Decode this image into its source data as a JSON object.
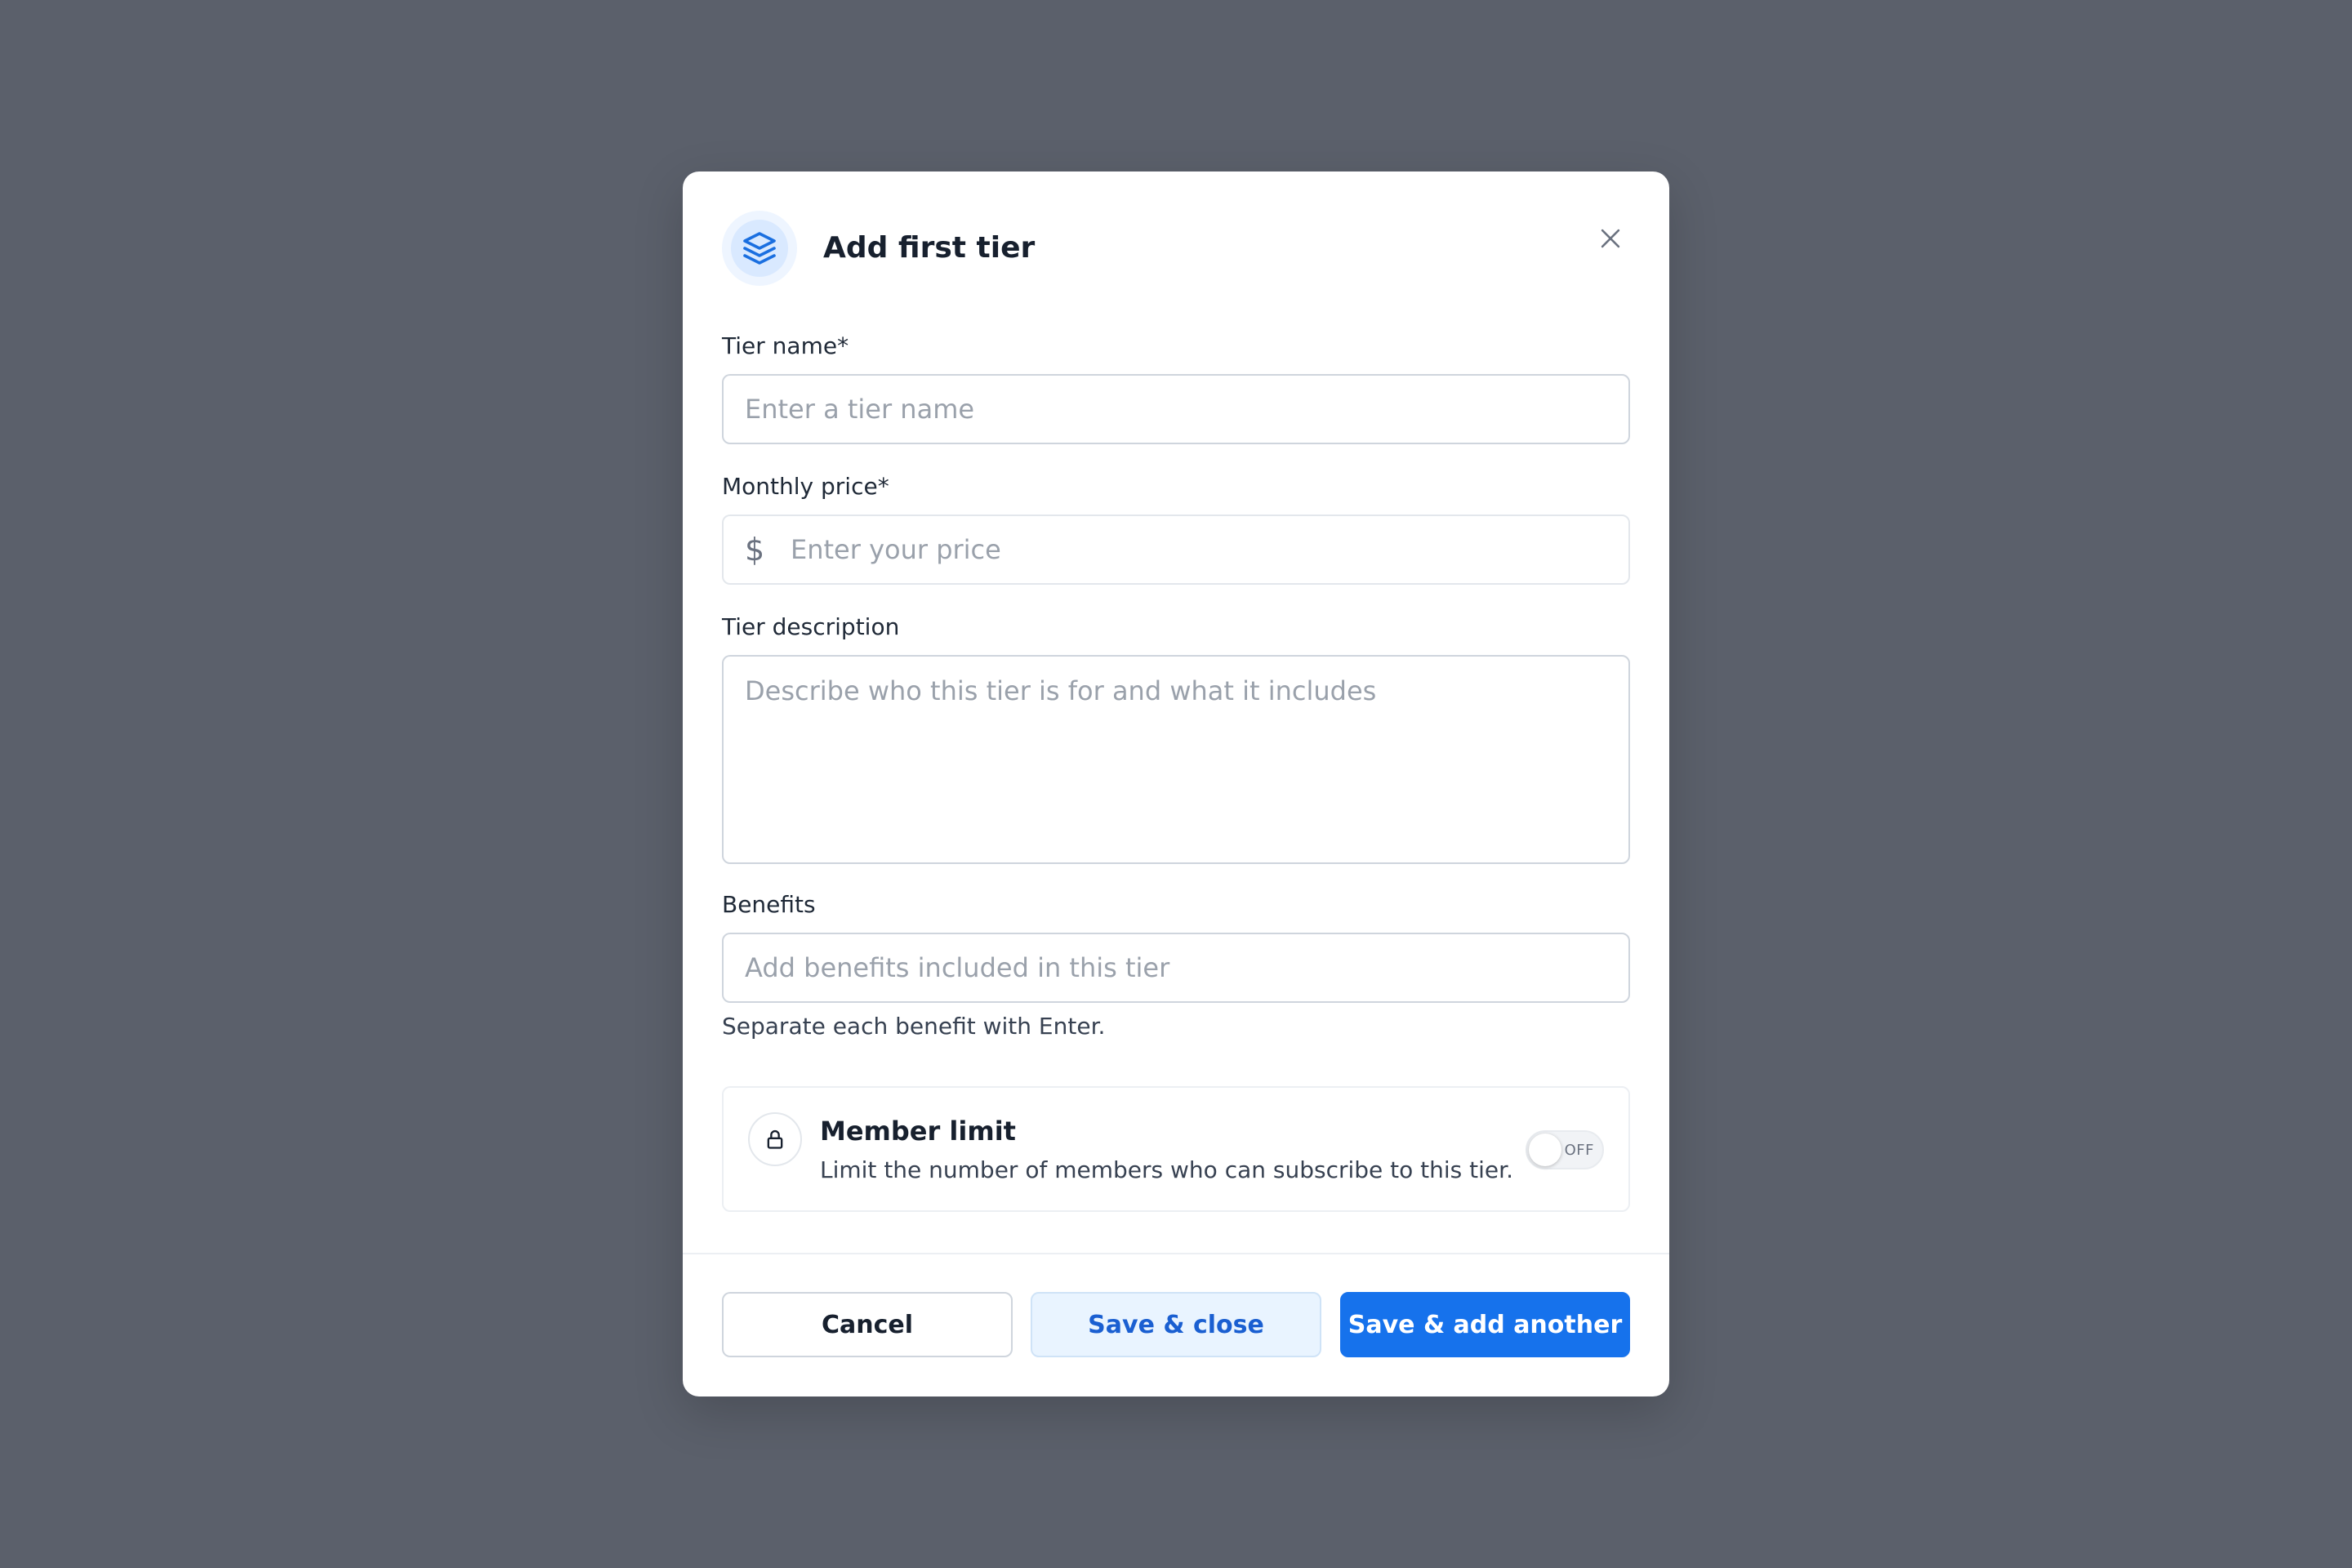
{
  "modal": {
    "title": "Add first tier",
    "icon": "layers-icon",
    "close_icon": "close-icon"
  },
  "fields": {
    "tier_name": {
      "label": "Tier name*",
      "placeholder": "Enter a tier name",
      "value": ""
    },
    "monthly_price": {
      "label": "Monthly price*",
      "currency_symbol": "$",
      "placeholder": "Enter your price",
      "value": ""
    },
    "tier_description": {
      "label": "Tier description",
      "placeholder": "Describe who this tier is for and what it includes",
      "value": ""
    },
    "benefits": {
      "label": "Benefits",
      "placeholder": "Add benefits included in this tier",
      "value": "",
      "hint": "Separate each benefit with Enter."
    }
  },
  "member_limit": {
    "title": "Member limit",
    "description": "Limit the number of members who can subscribe to this tier.",
    "icon": "lock-icon",
    "toggle_label": "OFF",
    "enabled": false
  },
  "footer": {
    "cancel_label": "Cancel",
    "save_close_label": "Save & close",
    "save_add_label": "Save & add another"
  },
  "colors": {
    "backdrop": "#5b606b",
    "primary": "#1672ec",
    "primary_light": "#e9f4ff"
  }
}
